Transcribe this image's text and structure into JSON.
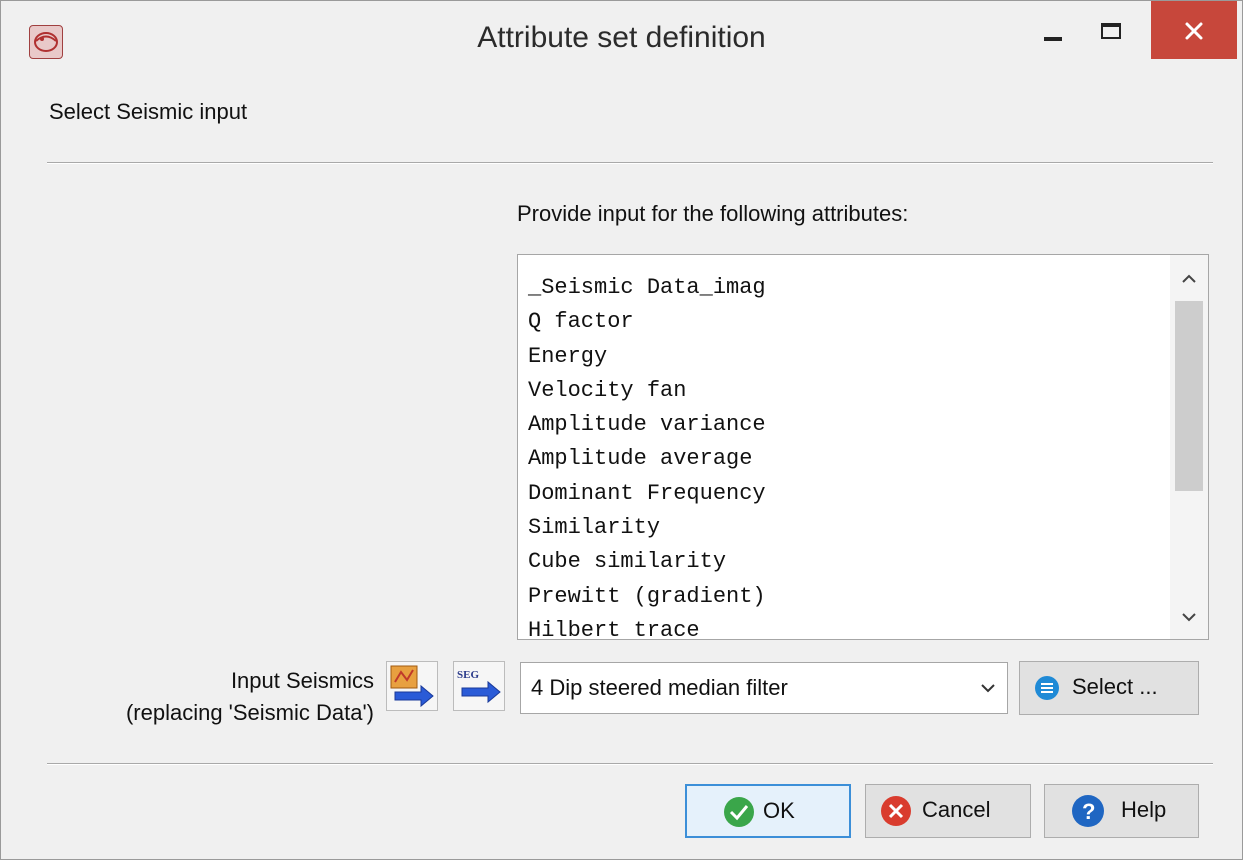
{
  "window": {
    "title": "Attribute set definition"
  },
  "section": {
    "label": "Select Seismic input"
  },
  "attributes_panel": {
    "prompt": "Provide input for the following attributes:",
    "items": [
      "_Seismic Data_imag",
      "Q factor",
      "Energy",
      "Velocity fan",
      "Amplitude variance",
      "Amplitude average",
      "Dominant Frequency",
      "Similarity",
      "Cube similarity",
      "Prewitt (gradient)",
      "Hilbert trace"
    ]
  },
  "input_seismics": {
    "label_line1": "Input Seismics",
    "label_line2": "(replacing 'Seismic Data')",
    "segy_icon_text": "SEG",
    "selected_value": "4 Dip steered median filter",
    "select_button": "Select ..."
  },
  "footer": {
    "ok": "OK",
    "cancel": "Cancel",
    "help": "Help"
  },
  "colors": {
    "close_button": "#c7473b",
    "ok_border": "#3c8fd8",
    "ok_icon": "#3aa64a",
    "cancel_icon": "#d93c2e",
    "help_icon": "#1f66c2",
    "select_icon": "#1f8ad6"
  },
  "icons": {
    "app": "opendtect-app-icon",
    "import": "import-arrow-icon",
    "segy": "segy-import-icon",
    "select": "list-icon",
    "ok": "checkmark-icon",
    "cancel": "x-circle-icon",
    "help": "question-icon"
  }
}
